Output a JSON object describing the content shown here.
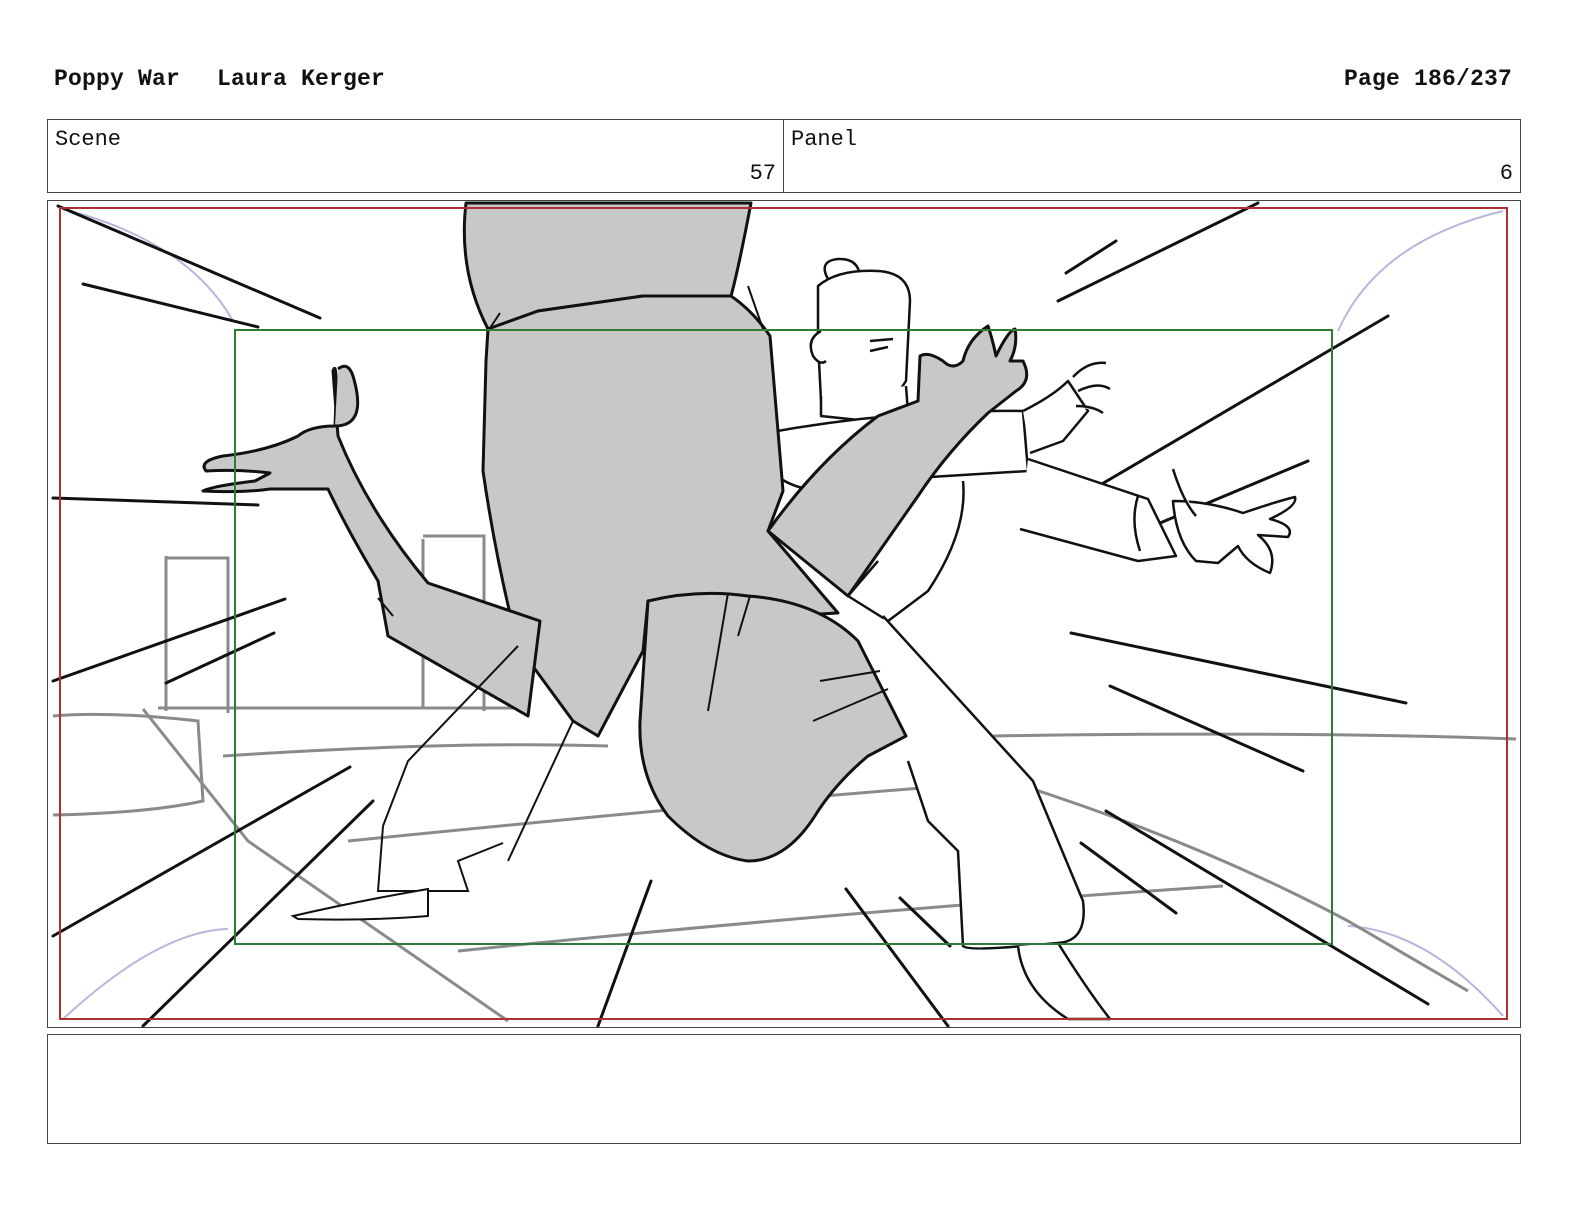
{
  "header": {
    "project": "Poppy War",
    "author": "Laura Kerger",
    "page": "Page 186/237"
  },
  "scene": {
    "label": "Scene",
    "value": "57"
  },
  "panel": {
    "label": "Panel",
    "value": "6"
  },
  "frame": {
    "safe_frame_color": "#b03030",
    "action_frame_color": "#2e7d32",
    "fill_gray": "#c8c8c8"
  },
  "notes": {
    "text": ""
  }
}
